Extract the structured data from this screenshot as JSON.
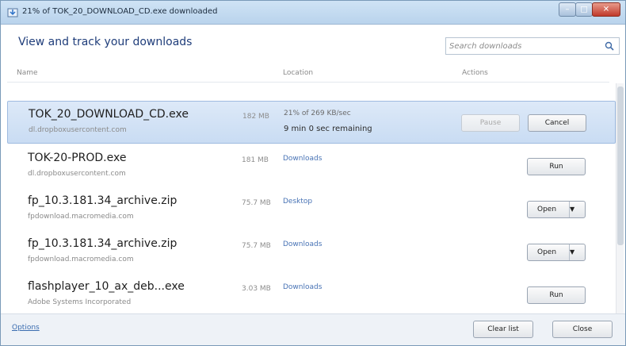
{
  "window": {
    "title": "21% of TOK_20_DOWNLOAD_CD.exe downloaded",
    "colors": {
      "accent": "#1f3d7a",
      "selection": "#cfe0f5",
      "link": "#4873b5"
    }
  },
  "header": {
    "heading": "View and track your downloads",
    "search": {
      "placeholder": "Search downloads",
      "icon": "search-icon"
    }
  },
  "columns": {
    "name": "Name",
    "location": "Location",
    "actions": "Actions"
  },
  "downloads": [
    {
      "name": "TOK_20_DOWNLOAD_CD.exe",
      "source": "dl.dropboxusercontent.com",
      "size": "182 MB",
      "status": "21% of 269 KB/sec",
      "remaining": "9 min 0 sec remaining",
      "progress_percent": 21,
      "selected": true,
      "buttons": {
        "pause": "Pause",
        "cancel": "Cancel"
      }
    },
    {
      "name": "TOK-20-PROD.exe",
      "source": "dl.dropboxusercontent.com",
      "size": "181 MB",
      "location": "Downloads",
      "action": "Run"
    },
    {
      "name": "fp_10.3.181.34_archive.zip",
      "source": "fpdownload.macromedia.com",
      "size": "75.7 MB",
      "location": "Desktop",
      "action": "Open"
    },
    {
      "name": "fp_10.3.181.34_archive.zip",
      "source": "fpdownload.macromedia.com",
      "size": "75.7 MB",
      "location": "Downloads",
      "action": "Open"
    },
    {
      "name": "flashplayer_10_ax_deb...exe",
      "source": "Adobe Systems Incorporated",
      "size": "3.03 MB",
      "location": "Downloads",
      "action": "Run"
    }
  ],
  "footer": {
    "options": "Options",
    "clear_list": "Clear list",
    "close": "Close"
  }
}
